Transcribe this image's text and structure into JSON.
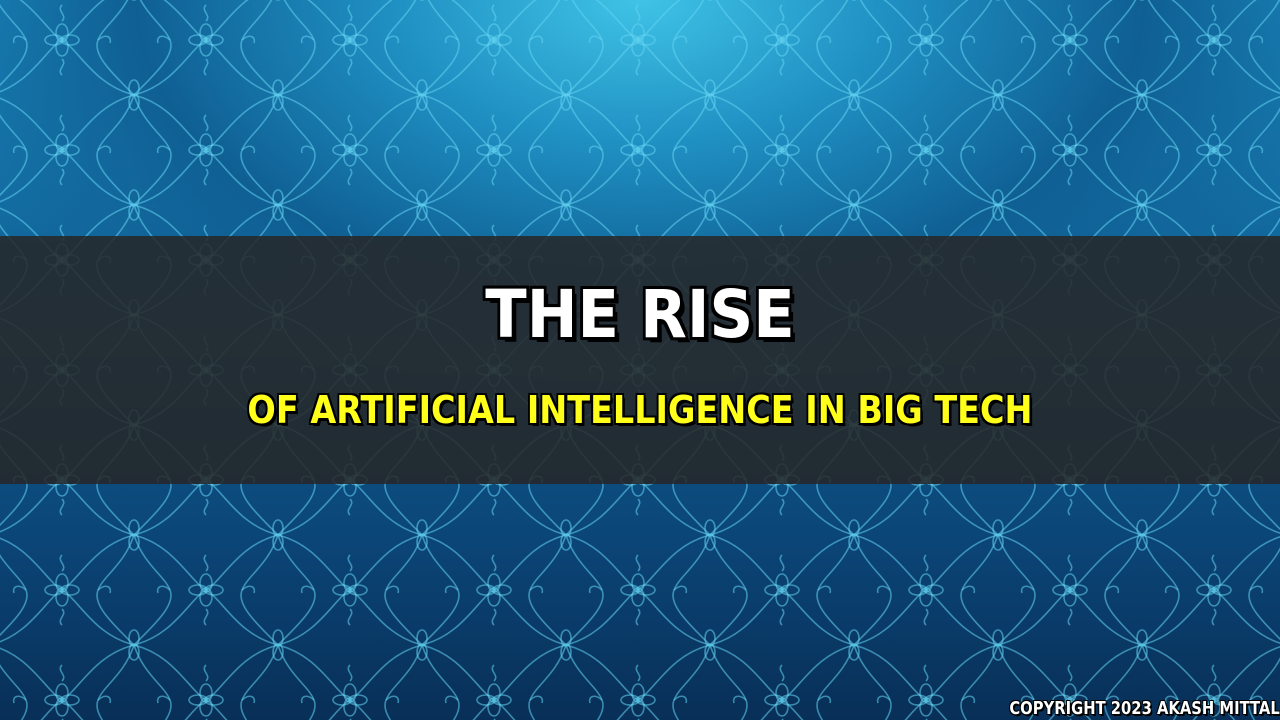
{
  "slide": {
    "title": "THE RISE",
    "subtitle": "OF ARTIFICIAL INTELLIGENCE IN BIG TECH",
    "copyright": "COPYRIGHT 2023 AKASH MITTAL"
  },
  "colors": {
    "title": "#ffffff",
    "subtitle": "#ffff1a",
    "banner": "#262626",
    "background_light": "#3fc3e6",
    "background_dark": "#082f57",
    "pattern_line": "#5fd0f0"
  },
  "decor": {
    "background_pattern": "ornamental-lattice"
  }
}
